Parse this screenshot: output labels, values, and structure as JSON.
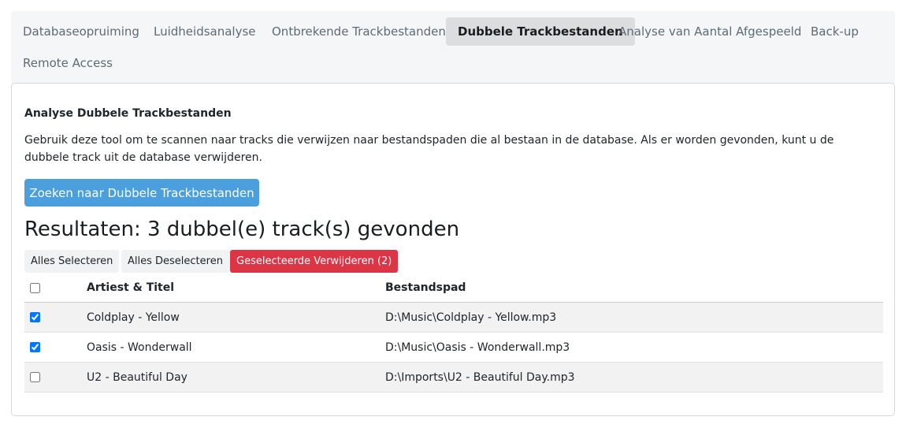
{
  "tabs": [
    {
      "label": "Databaseopruiming",
      "active": false
    },
    {
      "label": "Luidheidsanalyse",
      "active": false
    },
    {
      "label": "Ontbrekende Trackbestanden",
      "active": false
    },
    {
      "label": "Dubbele Trackbestanden",
      "active": true
    },
    {
      "label": "Analyse van Aantal Afgespeeld",
      "active": false
    },
    {
      "label": "Back-up",
      "active": false
    },
    {
      "label": "Remote Access",
      "active": false
    }
  ],
  "panel": {
    "heading": "Analyse Dubbele Trackbestanden",
    "description": "Gebruik deze tool om te scannen naar tracks die verwijzen naar bestandspaden die al bestaan in de database. Als er worden gevonden, kunt u de dubbele track uit de database verwijderen.",
    "search_button": "Zoeken naar Dubbele Trackbestanden",
    "results_title": "Resultaten: 3 dubbel(e) track(s) gevonden",
    "select_all": "Alles Selecteren",
    "deselect_all": "Alles Deselecteren",
    "delete_selected": "Geselecteerde Verwijderen (2)"
  },
  "table": {
    "columns": {
      "title": "Artiest & Titel",
      "path": "Bestandspad"
    },
    "header_checked": false,
    "rows": [
      {
        "title": "Coldplay - Yellow",
        "path": "D:\\Music\\Coldplay - Yellow.mp3",
        "checked": true
      },
      {
        "title": "Oasis - Wonderwall",
        "path": "D:\\Music\\Oasis - Wonderwall.mp3",
        "checked": true
      },
      {
        "title": "U2 - Beautiful Day",
        "path": "D:\\Imports\\U2 - Beautiful Day.mp3",
        "checked": false
      }
    ]
  },
  "colors": {
    "primary": "#4a9fdc",
    "danger": "#dc3545",
    "active_tab": "#dcdddf"
  }
}
